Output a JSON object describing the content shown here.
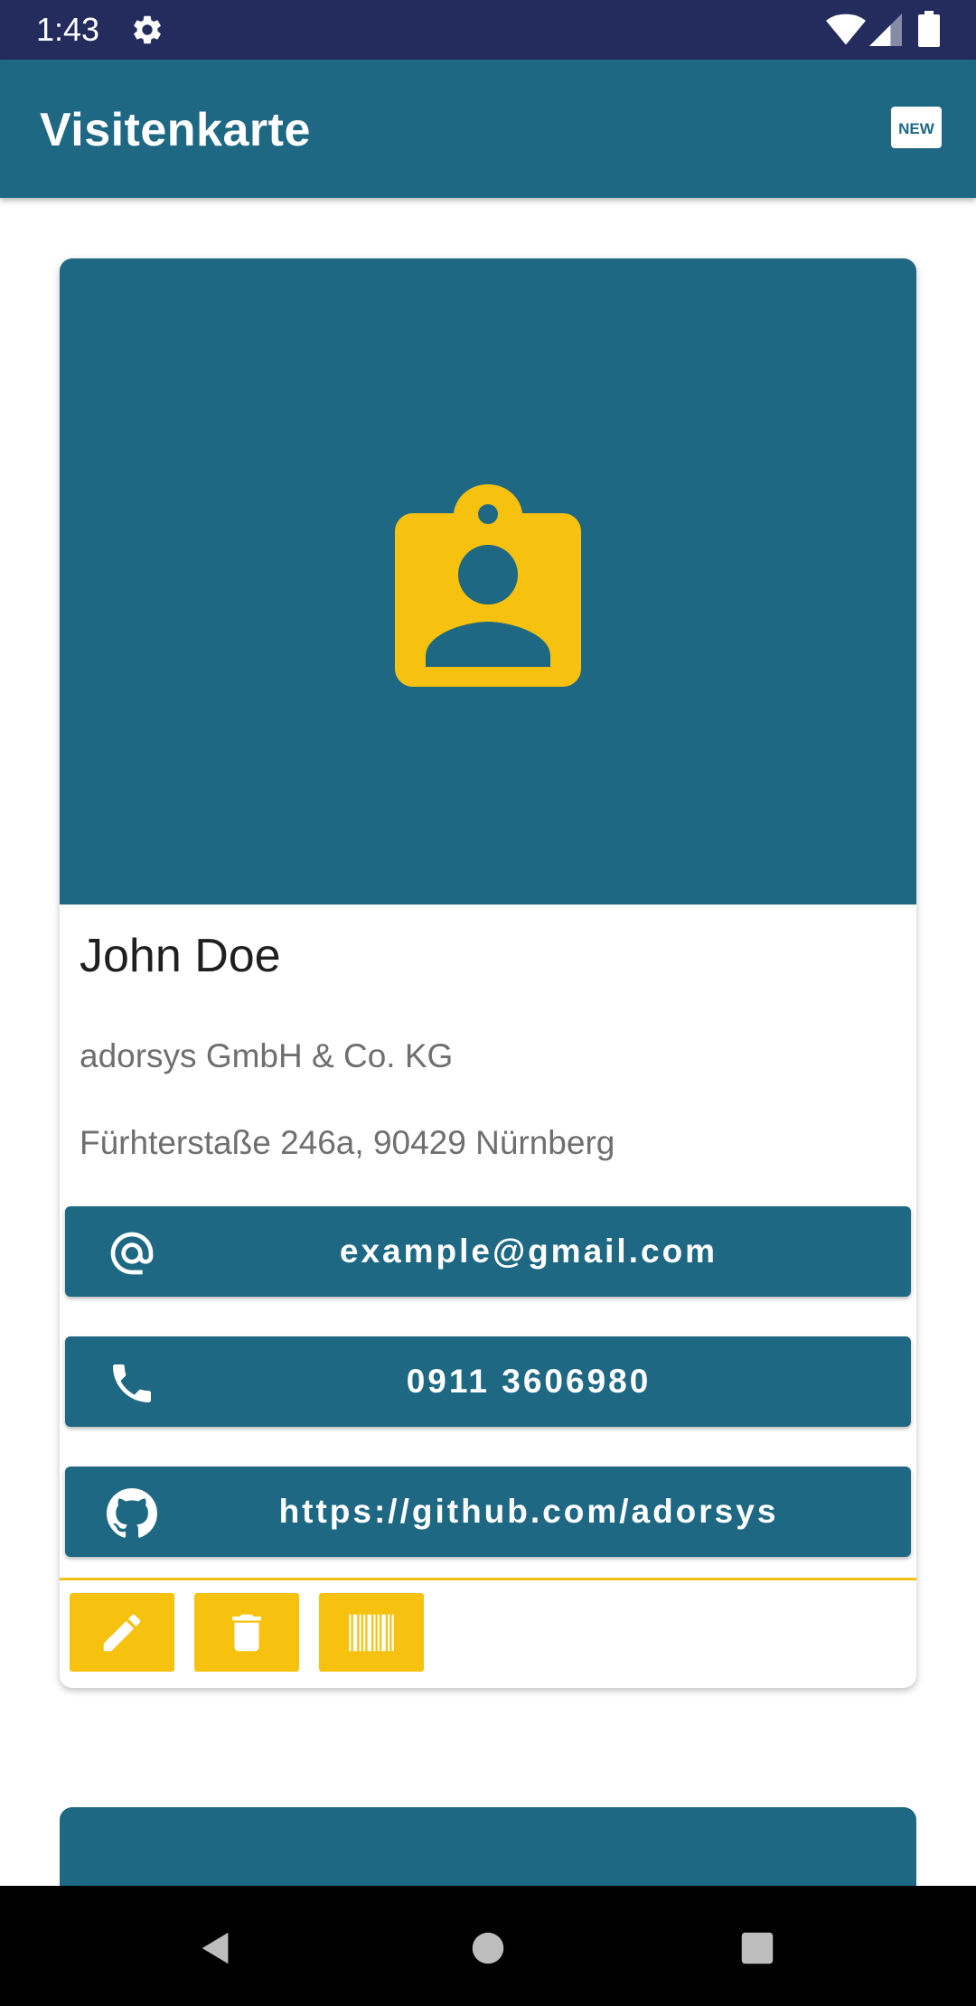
{
  "status_bar": {
    "time": "1:43"
  },
  "app_bar": {
    "title": "Visitenkarte",
    "new_icon_text": "NEW"
  },
  "card": {
    "name": "John Doe",
    "company": "adorsys GmbH & Co. KG",
    "address": "Fürhterstaße 246a, 90429 Nürnberg",
    "email": "example@gmail.com",
    "phone": "0911 3606980",
    "github": "https://github.com/adorsys"
  },
  "colors": {
    "primary": "#1e6883",
    "accent": "#f6c10f",
    "status_bar": "#242c5e"
  },
  "icons": {
    "contact_badge": "contact-badge-icon",
    "email": "at-icon",
    "phone": "phone-icon",
    "github": "github-icon",
    "edit": "pencil-icon",
    "delete": "trash-icon",
    "barcode": "barcode-icon"
  }
}
